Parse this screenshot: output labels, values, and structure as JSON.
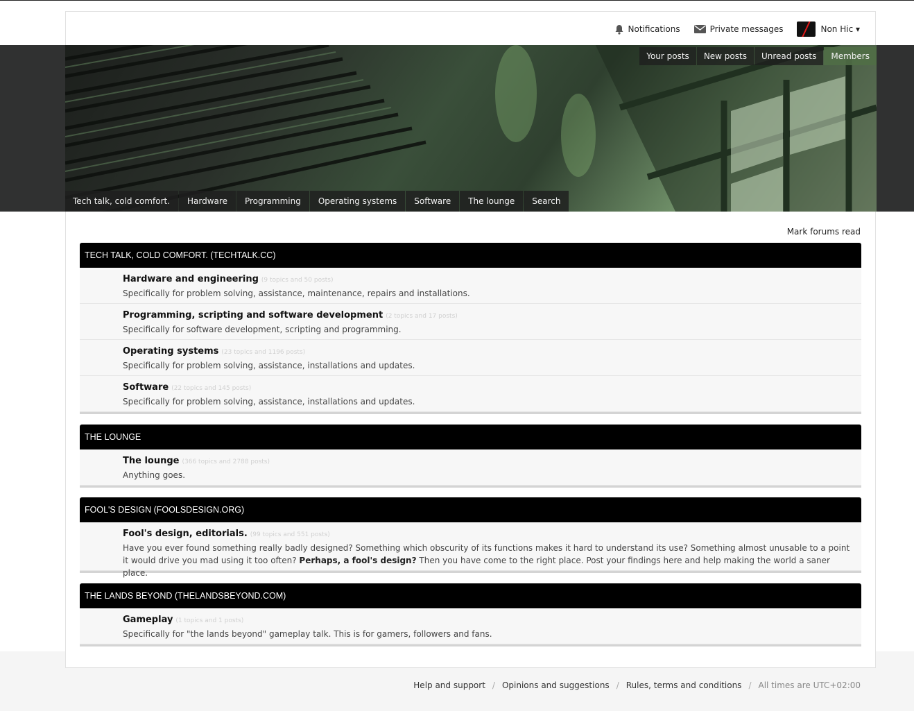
{
  "topbar": {
    "notifications": "Notifications",
    "private_messages": "Private messages",
    "username": "Non Hic ▾"
  },
  "nav_top": [
    "Your posts",
    "New posts",
    "Unread posts",
    "Members"
  ],
  "nav_bottom": [
    "Tech talk, cold comfort.",
    "Hardware",
    "Programming",
    "Operating systems",
    "Software",
    "The lounge",
    "Search"
  ],
  "mark_read": "Mark forums read",
  "categories": [
    {
      "title": "TECH TALK, COLD COMFORT. (TECHTALK.CC)",
      "forums": [
        {
          "name": "Hardware and engineering",
          "count": "(9 topics and 50 posts)",
          "desc": "Specifically for problem solving, assistance, maintenance, repairs and installations."
        },
        {
          "name": "Programming, scripting and software development",
          "count": "(2 topics and 17 posts)",
          "desc": "Specifically for software development, scripting and programming."
        },
        {
          "name": "Operating systems",
          "count": "(23 topics and 1196 posts)",
          "desc": "Specifically for problem solving, assistance, installations and updates."
        },
        {
          "name": "Software",
          "count": "(22 topics and 145 posts)",
          "desc": "Specifically for problem solving, assistance, installations and updates."
        }
      ]
    },
    {
      "title": "THE LOUNGE",
      "forums": [
        {
          "name": "The lounge",
          "count": "(366 topics and 2788 posts)",
          "desc": "Anything goes."
        }
      ]
    },
    {
      "title": "FOOL'S DESIGN (FOOLSDESIGN.ORG)",
      "forums": [
        {
          "name": "Fool's design, editorials.",
          "count": "(99 topics and 551 posts)",
          "desc_a": "Have you ever found something really badly designed? Something which obscurity of its functions makes it hard to understand its use? Something almost unusable to a point it would drive you mad using it too often? ",
          "desc_b": "Perhaps, a fool's design?",
          "desc_c": " Then you have come to the right place. Post your findings here and help making the world a saner place."
        }
      ]
    },
    {
      "title": "THE LANDS BEYOND (THELANDSBEYOND.COM)",
      "forums": [
        {
          "name": "Gameplay",
          "count": "(1 topics and 1 posts)",
          "desc": "Specifically for \"the lands beyond\" gameplay talk. This is for gamers, followers and fans."
        }
      ]
    }
  ],
  "footer": {
    "help": "Help and support",
    "opinions": "Opinions and suggestions",
    "rules": "Rules, terms and conditions",
    "timezone": "All times are UTC+02:00",
    "sep": "/"
  }
}
